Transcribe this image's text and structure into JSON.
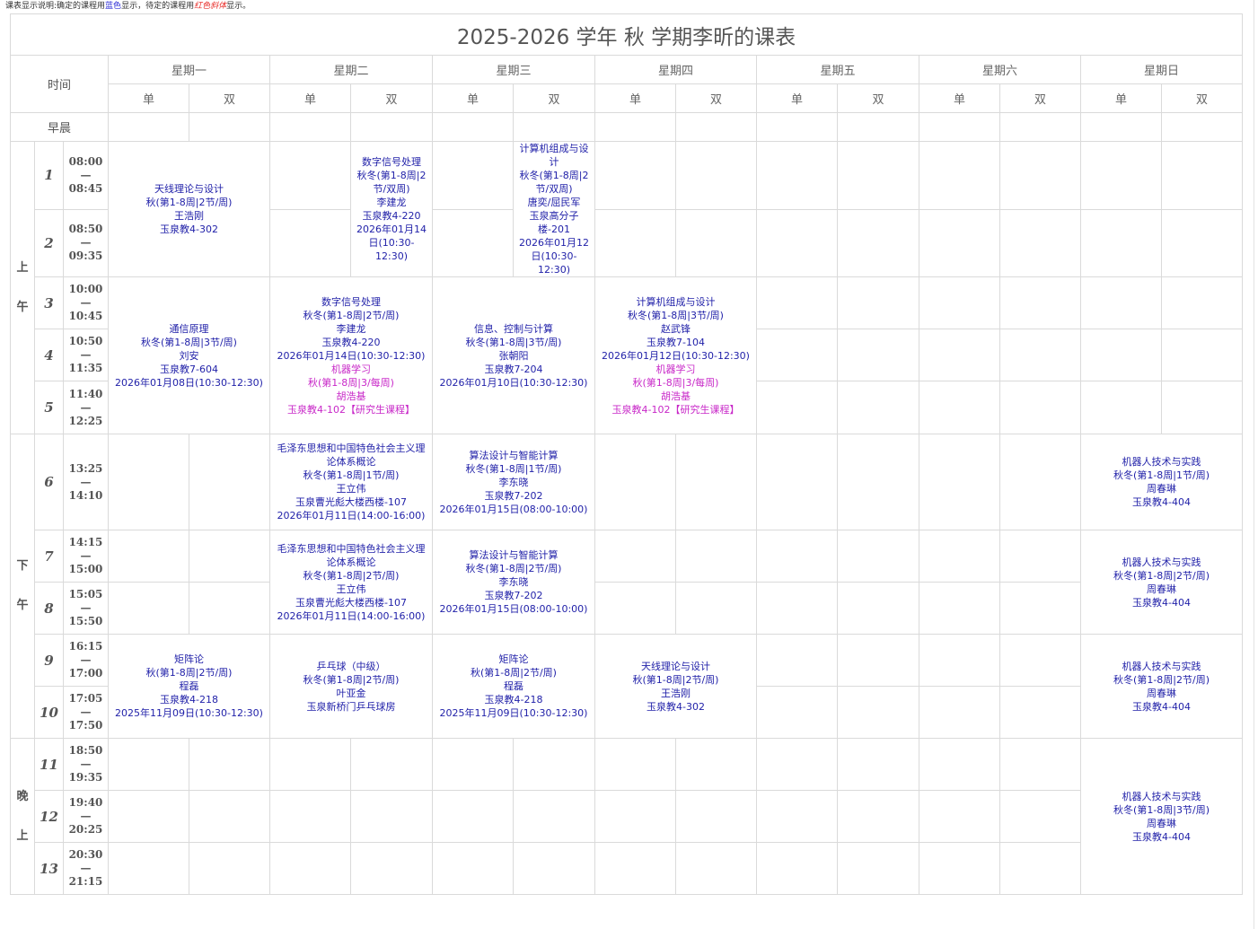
{
  "note": {
    "prefix": "课表显示说明:确定的课程用",
    "blue_word": "蓝色",
    "middle": "显示，待定的课程用",
    "red_word": "红色斜体",
    "suffix": "显示。"
  },
  "title": "2025-2026 学年 秋 学期李昕的课表",
  "header": {
    "time_label": "时间",
    "morning_label": "早晨",
    "days": [
      "星期一",
      "星期二",
      "星期三",
      "星期四",
      "星期五",
      "星期六",
      "星期日"
    ],
    "halves": [
      "单",
      "双"
    ],
    "time_separator": "—"
  },
  "colors": {
    "note_blue": "#2a2ad6",
    "note_red": "#e8302c",
    "course_confirmed": "#1f1fa8",
    "course_graduate": "#c828c8",
    "grid_border": "#dadada"
  },
  "sections": [
    {
      "label": "上午",
      "first_period": 1,
      "last_period": 5
    },
    {
      "label": "下午",
      "first_period": 6,
      "last_period": 10
    },
    {
      "label": "晚上",
      "first_period": 11,
      "last_period": 13
    }
  ],
  "periods": [
    {
      "number": 1,
      "start": "08:00",
      "end": "08:45"
    },
    {
      "number": 2,
      "start": "08:50",
      "end": "09:35"
    },
    {
      "number": 3,
      "start": "10:00",
      "end": "10:45"
    },
    {
      "number": 4,
      "start": "10:50",
      "end": "11:35"
    },
    {
      "number": 5,
      "start": "11:40",
      "end": "12:25"
    },
    {
      "number": 6,
      "start": "13:25",
      "end": "14:10"
    },
    {
      "number": 7,
      "start": "14:15",
      "end": "15:00"
    },
    {
      "number": 8,
      "start": "15:05",
      "end": "15:50"
    },
    {
      "number": 9,
      "start": "16:15",
      "end": "17:00"
    },
    {
      "number": 10,
      "start": "17:05",
      "end": "17:50"
    },
    {
      "number": 11,
      "start": "18:50",
      "end": "19:35"
    },
    {
      "number": 12,
      "start": "19:40",
      "end": "20:25"
    },
    {
      "number": 13,
      "start": "20:30",
      "end": "21:15"
    }
  ],
  "courses": [
    {
      "day": 0,
      "half": null,
      "first_period": 1,
      "last_period": 2,
      "blocks": [
        {
          "color": "#1f1fa8",
          "lines": [
            "天线理论与设计",
            "秋(第1-8周|2节/周)",
            "王浩刚",
            "玉泉教4-302"
          ]
        }
      ]
    },
    {
      "day": 0,
      "half": null,
      "first_period": 3,
      "last_period": 5,
      "blocks": [
        {
          "color": "#1f1fa8",
          "lines": [
            "通信原理",
            "秋冬(第1-8周|3节/周)",
            "刘安",
            "玉泉教7-604",
            "2026年01月08日(10:30-12:30)"
          ]
        }
      ]
    },
    {
      "day": 0,
      "half": null,
      "first_period": 9,
      "last_period": 10,
      "blocks": [
        {
          "color": "#1f1fa8",
          "lines": [
            "矩阵论",
            "秋(第1-8周|2节/周)",
            "程磊",
            "玉泉教4-218",
            "2025年11月09日(10:30-12:30)"
          ]
        }
      ]
    },
    {
      "day": 1,
      "half": 1,
      "first_period": 1,
      "last_period": 2,
      "blocks": [
        {
          "color": "#1f1fa8",
          "lines": [
            "数字信号处理",
            "秋冬(第1-8周|2节/双周)",
            "李建龙",
            "玉泉教4-220",
            "2026年01月14日(10:30-12:30)"
          ]
        }
      ]
    },
    {
      "day": 1,
      "half": null,
      "first_period": 3,
      "last_period": 5,
      "blocks": [
        {
          "color": "#1f1fa8",
          "lines": [
            "数字信号处理",
            "秋冬(第1-8周|2节/周)",
            "李建龙",
            "玉泉教4-220",
            "2026年01月14日(10:30-12:30)"
          ]
        },
        {
          "color": "#c828c8",
          "lines": [
            "机器学习",
            "秋(第1-8周|3/每周)",
            "胡浩基",
            "玉泉教4-102【研究生课程】"
          ]
        }
      ]
    },
    {
      "day": 1,
      "half": null,
      "first_period": 6,
      "last_period": 6,
      "blocks": [
        {
          "color": "#1f1fa8",
          "lines": [
            "毛泽东思想和中国特色社会主义理论体系概论",
            "秋冬(第1-8周|1节/周)",
            "王立伟",
            "玉泉曹光彪大楼西楼-107",
            "2026年01月11日(14:00-16:00)"
          ]
        }
      ]
    },
    {
      "day": 1,
      "half": null,
      "first_period": 7,
      "last_period": 8,
      "blocks": [
        {
          "color": "#1f1fa8",
          "lines": [
            "毛泽东思想和中国特色社会主义理论体系概论",
            "秋冬(第1-8周|2节/周)",
            "王立伟",
            "玉泉曹光彪大楼西楼-107",
            "2026年01月11日(14:00-16:00)"
          ]
        }
      ]
    },
    {
      "day": 1,
      "half": null,
      "first_period": 9,
      "last_period": 10,
      "blocks": [
        {
          "color": "#1f1fa8",
          "lines": [
            "乒乓球（中级）",
            "秋冬(第1-8周|2节/周)",
            "叶亚金",
            "玉泉新桥门乒乓球房"
          ]
        }
      ]
    },
    {
      "day": 2,
      "half": 1,
      "first_period": 1,
      "last_period": 2,
      "blocks": [
        {
          "color": "#1f1fa8",
          "lines": [
            "计算机组成与设计",
            "秋冬(第1-8周|2节/双周)",
            "唐奕/屈民军",
            "玉泉高分子楼-201",
            "2026年01月12日(10:30-12:30)"
          ]
        }
      ]
    },
    {
      "day": 2,
      "half": null,
      "first_period": 3,
      "last_period": 5,
      "blocks": [
        {
          "color": "#1f1fa8",
          "lines": [
            "信息、控制与计算",
            "秋冬(第1-8周|3节/周)",
            "张朝阳",
            "玉泉教7-204",
            "2026年01月10日(10:30-12:30)"
          ]
        }
      ]
    },
    {
      "day": 2,
      "half": null,
      "first_period": 6,
      "last_period": 6,
      "blocks": [
        {
          "color": "#1f1fa8",
          "lines": [
            "算法设计与智能计算",
            "秋冬(第1-8周|1节/周)",
            "李东晓",
            "玉泉教7-202",
            "2026年01月15日(08:00-10:00)"
          ]
        }
      ]
    },
    {
      "day": 2,
      "half": null,
      "first_period": 7,
      "last_period": 8,
      "blocks": [
        {
          "color": "#1f1fa8",
          "lines": [
            "算法设计与智能计算",
            "秋冬(第1-8周|2节/周)",
            "李东晓",
            "玉泉教7-202",
            "2026年01月15日(08:00-10:00)"
          ]
        }
      ]
    },
    {
      "day": 2,
      "half": null,
      "first_period": 9,
      "last_period": 10,
      "blocks": [
        {
          "color": "#1f1fa8",
          "lines": [
            "矩阵论",
            "秋(第1-8周|2节/周)",
            "程磊",
            "玉泉教4-218",
            "2025年11月09日(10:30-12:30)"
          ]
        }
      ]
    },
    {
      "day": 3,
      "half": null,
      "first_period": 3,
      "last_period": 5,
      "blocks": [
        {
          "color": "#1f1fa8",
          "lines": [
            "计算机组成与设计",
            "秋冬(第1-8周|3节/周)",
            "赵武锋",
            "玉泉教7-104",
            "2026年01月12日(10:30-12:30)"
          ]
        },
        {
          "color": "#c828c8",
          "lines": [
            "机器学习",
            "秋(第1-8周|3/每周)",
            "胡浩基",
            "玉泉教4-102【研究生课程】"
          ]
        }
      ]
    },
    {
      "day": 3,
      "half": null,
      "first_period": 9,
      "last_period": 10,
      "blocks": [
        {
          "color": "#1f1fa8",
          "lines": [
            "天线理论与设计",
            "秋(第1-8周|2节/周)",
            "王浩刚",
            "玉泉教4-302"
          ]
        }
      ]
    },
    {
      "day": 6,
      "half": null,
      "first_period": 6,
      "last_period": 6,
      "blocks": [
        {
          "color": "#1f1fa8",
          "lines": [
            "机器人技术与实践",
            "秋冬(第1-8周|1节/周)",
            "周春琳",
            "玉泉教4-404"
          ]
        }
      ]
    },
    {
      "day": 6,
      "half": null,
      "first_period": 7,
      "last_period": 8,
      "blocks": [
        {
          "color": "#1f1fa8",
          "lines": [
            "机器人技术与实践",
            "秋冬(第1-8周|2节/周)",
            "周春琳",
            "玉泉教4-404"
          ]
        }
      ]
    },
    {
      "day": 6,
      "half": null,
      "first_period": 9,
      "last_period": 10,
      "blocks": [
        {
          "color": "#1f1fa8",
          "lines": [
            "机器人技术与实践",
            "秋冬(第1-8周|2节/周)",
            "周春琳",
            "玉泉教4-404"
          ]
        }
      ]
    },
    {
      "day": 6,
      "half": null,
      "first_period": 11,
      "last_period": 13,
      "blocks": [
        {
          "color": "#1f1fa8",
          "lines": [
            "机器人技术与实践",
            "秋冬(第1-8周|3节/周)",
            "周春琳",
            "玉泉教4-404"
          ]
        }
      ]
    }
  ]
}
